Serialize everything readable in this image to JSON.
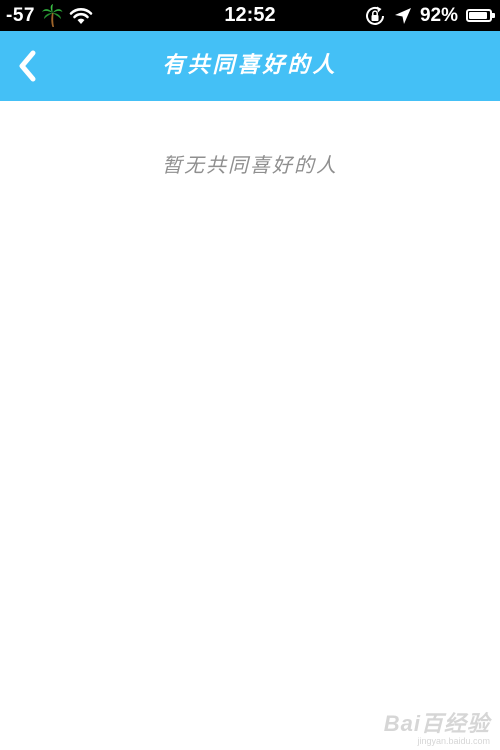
{
  "status_bar": {
    "signal": "-57",
    "carrier_icon": "palm-tree-icon",
    "wifi_icon": "wifi-icon",
    "time": "12:52",
    "rotation_lock_icon": "rotation-lock-icon",
    "location_icon": "location-arrow-icon",
    "battery_percent": "92%",
    "battery_level": 0.92
  },
  "nav_bar": {
    "back_icon": "chevron-left-icon",
    "title": "有共同喜好的人",
    "color": "#44c0f6"
  },
  "content": {
    "empty_message": "暂无共同喜好的人"
  },
  "watermark": {
    "logo": "Bai百经验",
    "url": "jingyan.baidu.com"
  }
}
